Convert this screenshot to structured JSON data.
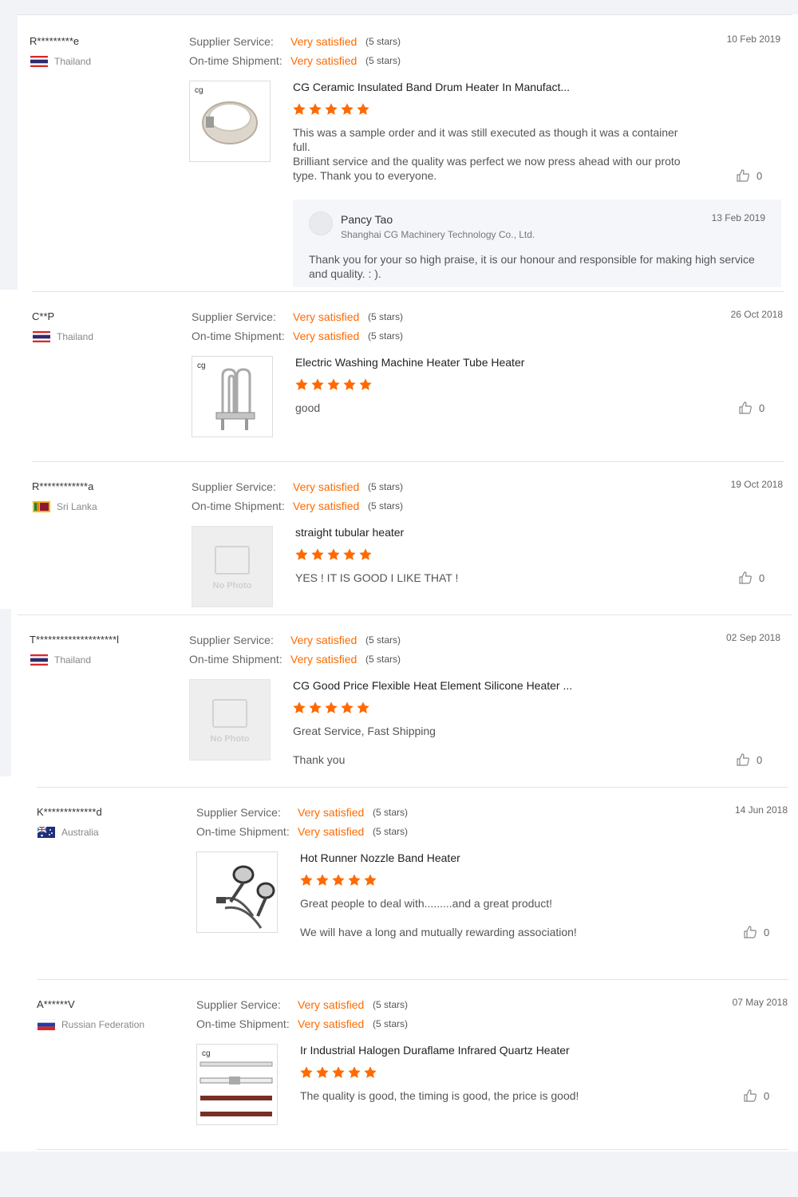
{
  "rating_labels": {
    "supplier": "Supplier Service:",
    "shipment": "On-time Shipment:"
  },
  "colors": {
    "accent": "#ff6a00",
    "star": "#ff6a00"
  },
  "reviews": [
    {
      "name": "R*********e",
      "country": "Thailand",
      "flag": "thailand-flag",
      "date": "10 Feb 2019",
      "supplier_value": "Very satisfied",
      "supplier_stars": "(5 stars)",
      "shipment_value": "Very satisfied",
      "shipment_stars": "(5 stars)",
      "product_title": "CG Ceramic Insulated Band Drum Heater In Manufact...",
      "rating": 5,
      "comment_lines": [
        "This was a sample order and it was still executed as though it was a container",
        "full.",
        "Brilliant service and the quality was perfect we now press ahead with our proto",
        "type. Thank you to everyone."
      ],
      "likes": "0",
      "reply": {
        "name": "Pancy Tao",
        "company": "Shanghai CG Machinery Technology Co., Ltd.",
        "date": "13 Feb 2019",
        "text_lines": [
          "Thank you for your so high praise, it is our honour and responsible for making high service",
          "and quality. : )."
        ]
      }
    },
    {
      "name": "C**P",
      "country": "Thailand",
      "flag": "thailand-flag",
      "date": "26 Oct 2018",
      "supplier_value": "Very satisfied",
      "supplier_stars": "(5 stars)",
      "shipment_value": "Very satisfied",
      "shipment_stars": "(5 stars)",
      "product_title": "Electric Washing Machine Heater Tube Heater",
      "rating": 5,
      "comment_lines": [
        "good"
      ],
      "likes": "0"
    },
    {
      "name": "R************a",
      "country": "Sri Lanka",
      "flag": "sri-lanka-flag",
      "date": "19 Oct 2018",
      "supplier_value": "Very satisfied",
      "supplier_stars": "(5 stars)",
      "shipment_value": "Very satisfied",
      "shipment_stars": "(5 stars)",
      "product_title": "straight tubular heater",
      "rating": 5,
      "comment_lines": [
        "YES !  IT IS GOOD I LIKE THAT !"
      ],
      "likes": "0",
      "no_photo_text": "No Photo"
    },
    {
      "name": "T********************l",
      "country": "Thailand",
      "flag": "thailand-flag",
      "date": "02 Sep 2018",
      "supplier_value": "Very satisfied",
      "supplier_stars": "(5 stars)",
      "shipment_value": "Very satisfied",
      "shipment_stars": "(5 stars)",
      "product_title": "CG Good Price Flexible Heat Element Silicone Heater ...",
      "rating": 5,
      "comment_lines": [
        "Great Service, Fast Shipping",
        "",
        "Thank you"
      ],
      "likes": "0",
      "no_photo_text": "No Photo"
    },
    {
      "name": "K*************d",
      "country": "Australia",
      "flag": "australia-flag",
      "date": "14 Jun 2018",
      "supplier_value": "Very satisfied",
      "supplier_stars": "(5 stars)",
      "shipment_value": "Very satisfied",
      "shipment_stars": "(5 stars)",
      "product_title": "Hot Runner Nozzle Band Heater",
      "rating": 5,
      "comment_lines": [
        "Great people to deal with.........and a great product!",
        "",
        "We will have a long and mutually rewarding association!"
      ],
      "likes": "0"
    },
    {
      "name": "A******V",
      "country": "Russian Federation",
      "flag": "russia-flag",
      "date": "07 May 2018",
      "supplier_value": "Very satisfied",
      "supplier_stars": "(5 stars)",
      "shipment_value": "Very satisfied",
      "shipment_stars": "(5 stars)",
      "product_title": "Ir Industrial Halogen Duraflame Infrared Quartz Heater",
      "rating": 5,
      "comment_lines": [
        "The quality is good, the timing is good, the price is good!"
      ],
      "likes": "0"
    }
  ]
}
